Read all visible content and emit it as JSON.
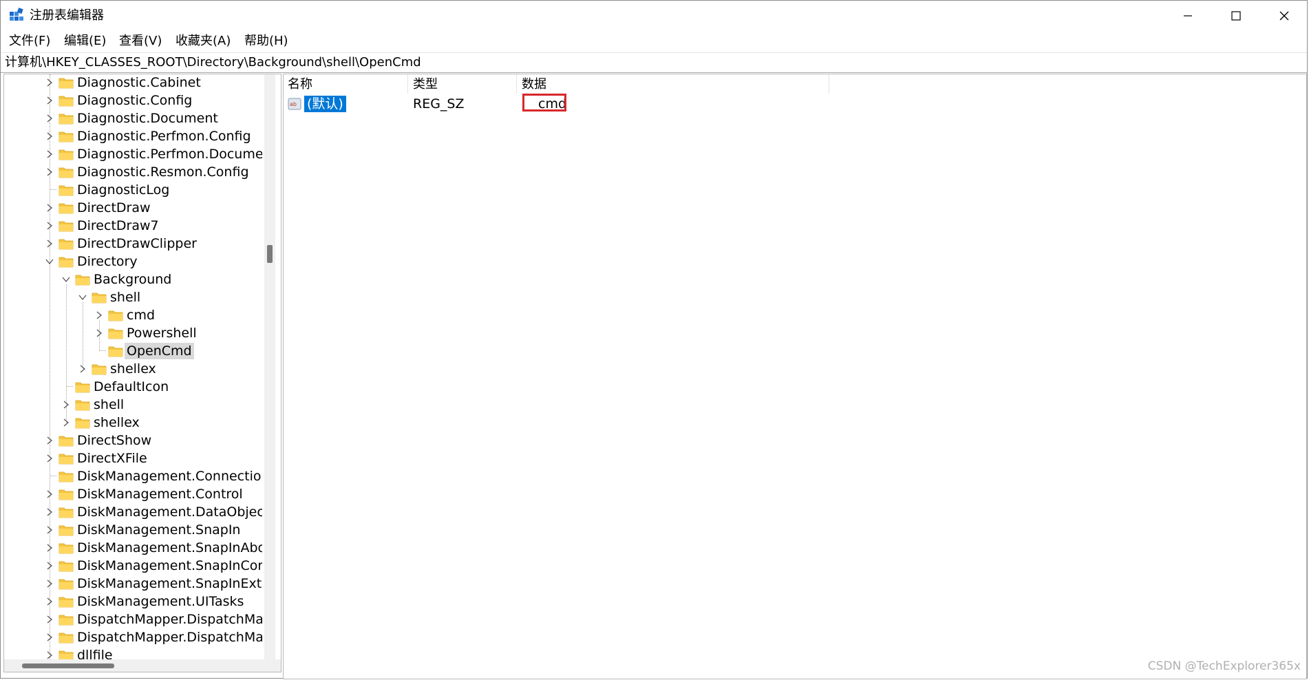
{
  "window": {
    "title": "注册表编辑器",
    "controls": {
      "minimize": "minimize-icon",
      "maximize": "maximize-icon",
      "close": "close-icon"
    }
  },
  "menu": [
    {
      "label": "文件(F)"
    },
    {
      "label": "编辑(E)"
    },
    {
      "label": "查看(V)"
    },
    {
      "label": "收藏夹(A)"
    },
    {
      "label": "帮助(H)"
    }
  ],
  "address": "计算机\\HKEY_CLASSES_ROOT\\Directory\\Background\\shell\\OpenCmd",
  "tree": [
    {
      "label": "Diagnostic.Cabinet",
      "expander": "collapsed"
    },
    {
      "label": "Diagnostic.Config",
      "expander": "collapsed"
    },
    {
      "label": "Diagnostic.Document",
      "expander": "collapsed"
    },
    {
      "label": "Diagnostic.Perfmon.Config",
      "expander": "collapsed"
    },
    {
      "label": "Diagnostic.Perfmon.Document",
      "expander": "collapsed"
    },
    {
      "label": "Diagnostic.Resmon.Config",
      "expander": "collapsed"
    },
    {
      "label": "DiagnosticLog",
      "expander": "none"
    },
    {
      "label": "DirectDraw",
      "expander": "collapsed"
    },
    {
      "label": "DirectDraw7",
      "expander": "collapsed"
    },
    {
      "label": "DirectDrawClipper",
      "expander": "collapsed"
    },
    {
      "label": "Directory",
      "expander": "expanded"
    },
    {
      "label": "Background",
      "expander": "expanded"
    },
    {
      "label": "shell",
      "expander": "expanded"
    },
    {
      "label": "cmd",
      "expander": "collapsed"
    },
    {
      "label": "Powershell",
      "expander": "collapsed"
    },
    {
      "label": "OpenCmd",
      "expander": "none",
      "selected": true
    },
    {
      "label": "shellex",
      "expander": "collapsed"
    },
    {
      "label": "DefaultIcon",
      "expander": "none"
    },
    {
      "label": "shell",
      "expander": "collapsed"
    },
    {
      "label": "shellex",
      "expander": "collapsed"
    },
    {
      "label": "DirectShow",
      "expander": "collapsed"
    },
    {
      "label": "DirectXFile",
      "expander": "collapsed"
    },
    {
      "label": "DiskManagement.Connection",
      "expander": "none"
    },
    {
      "label": "DiskManagement.Control",
      "expander": "collapsed"
    },
    {
      "label": "DiskManagement.DataObject",
      "expander": "collapsed"
    },
    {
      "label": "DiskManagement.SnapIn",
      "expander": "collapsed"
    },
    {
      "label": "DiskManagement.SnapInAbout",
      "expander": "collapsed"
    },
    {
      "label": "DiskManagement.SnapInComp",
      "expander": "collapsed"
    },
    {
      "label": "DiskManagement.SnapInExtens",
      "expander": "collapsed"
    },
    {
      "label": "DiskManagement.UITasks",
      "expander": "collapsed"
    },
    {
      "label": "DispatchMapper.DispatchMap",
      "expander": "collapsed"
    },
    {
      "label": "DispatchMapper.DispatchMap",
      "expander": "collapsed"
    },
    {
      "label": "dllfile",
      "expander": "collapsed"
    }
  ],
  "values": {
    "headers": {
      "name": "名称",
      "type": "类型",
      "data": "数据"
    },
    "rows": [
      {
        "name": "(默认)",
        "type": "REG_SZ",
        "data": "cmd",
        "icon": "string-value-icon"
      }
    ]
  },
  "watermark": "CSDN @TechExplorer365x",
  "colors": {
    "selection": "#0078d7",
    "highlight": "#d9262c",
    "folder": "#f4c542"
  }
}
